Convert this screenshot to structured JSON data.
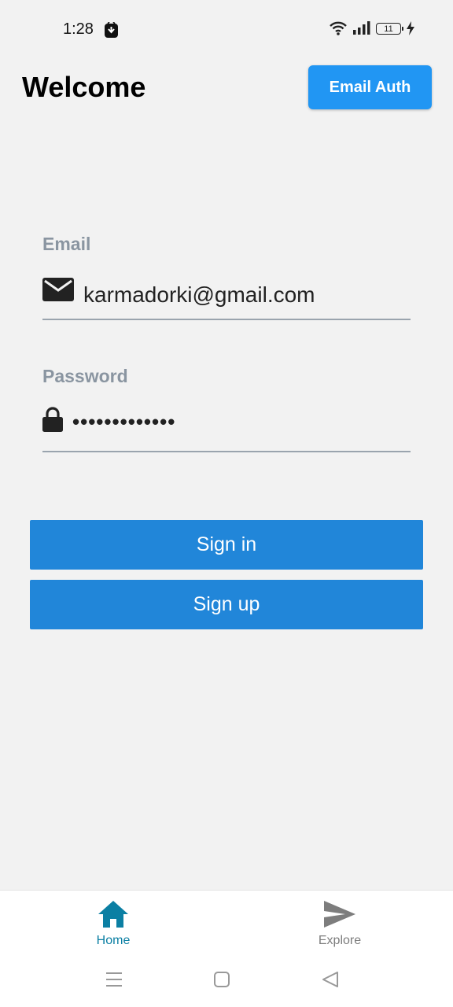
{
  "status_bar": {
    "time": "1:28",
    "battery_level": "11"
  },
  "header": {
    "title": "Welcome",
    "email_auth_label": "Email Auth"
  },
  "form": {
    "email_label": "Email",
    "email_value": "karmadorki@gmail.com",
    "password_label": "Password",
    "password_mask": "•••••••••••••"
  },
  "actions": {
    "sign_in_label": "Sign in",
    "sign_up_label": "Sign up"
  },
  "bottom_nav": {
    "items": [
      {
        "label": "Home",
        "icon": "home-icon",
        "active": true
      },
      {
        "label": "Explore",
        "icon": "send-icon",
        "active": false
      }
    ]
  },
  "colors": {
    "accent": "#2196f3",
    "button": "#2186d9",
    "nav_active": "#0b7fa3",
    "nav_inactive": "#7d7d7d",
    "label_gray": "#8a95a1"
  }
}
